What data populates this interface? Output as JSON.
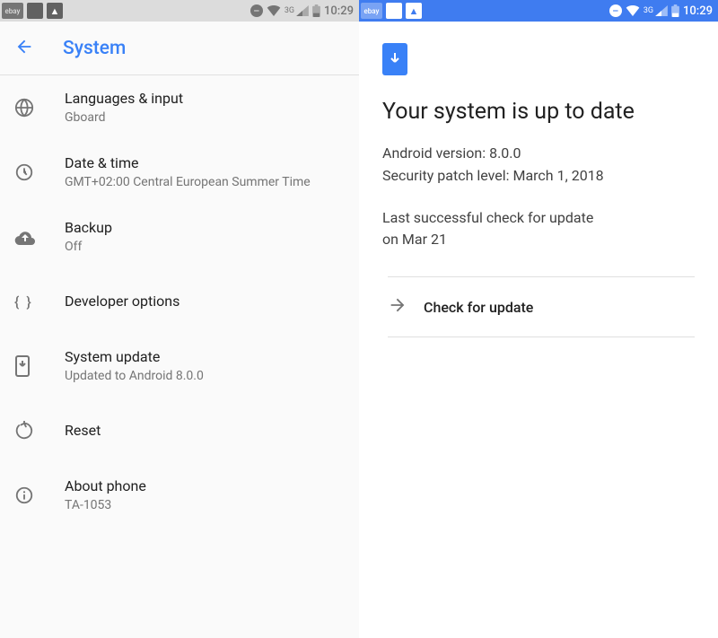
{
  "statusbar": {
    "ebay": "ebay",
    "net_label": "3G",
    "time": "10:29"
  },
  "left": {
    "header_title": "System",
    "items": [
      {
        "title": "Languages & input",
        "subtitle": "Gboard"
      },
      {
        "title": "Date & time",
        "subtitle": "GMT+02:00 Central European Summer Time"
      },
      {
        "title": "Backup",
        "subtitle": "Off"
      },
      {
        "title": "Developer options",
        "subtitle": ""
      },
      {
        "title": "System update",
        "subtitle": "Updated to Android 8.0.0"
      },
      {
        "title": "Reset",
        "subtitle": ""
      },
      {
        "title": "About phone",
        "subtitle": "TA-1053"
      }
    ]
  },
  "right": {
    "title": "Your system is up to date",
    "android_version_label": "Android version: ",
    "android_version": "8.0.0",
    "patch_label": "Security patch level: ",
    "patch_value": "March 1, 2018",
    "last_check_line1": "Last successful check for update",
    "last_check_line2": "on Mar 21",
    "check_button": "Check for update"
  }
}
